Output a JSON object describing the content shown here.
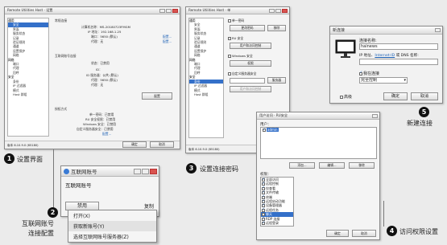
{
  "win1": {
    "title": "Remote Utilities Host · 设置",
    "tree": [
      {
        "label": "通用",
        "group": true
      },
      {
        "label": "安全",
        "group": false
      },
      {
        "label": "界面",
        "group": false
      },
      {
        "label": "服务状态",
        "group": false
      },
      {
        "label": "记录",
        "group": false
      },
      {
        "label": "验证规则",
        "group": false
      },
      {
        "label": "通道",
        "group": false
      },
      {
        "label": "设置保护",
        "group": false
      },
      {
        "label": "网络",
        "group": false
      },
      {
        "label": "网络",
        "group": true
      },
      {
        "label": "端口",
        "group": false
      },
      {
        "label": "代理",
        "group": false
      },
      {
        "label": "回呼",
        "group": false
      },
      {
        "label": "安全",
        "group": true
      },
      {
        "label": "身份",
        "group": false
      },
      {
        "label": "IP 过滤器",
        "group": false
      },
      {
        "label": "模式",
        "group": false
      },
      {
        "label": "Host 群组",
        "group": false
      }
    ],
    "section1": "常规连接",
    "computer_name_label": "计算机名称：",
    "computer_name_value": "MS-20180723FMGM",
    "ip_label": "IP 地址：",
    "ip_value": "192.168.1.25",
    "port_label": "端口：",
    "port_value": "5650 (默认)",
    "proxy_label": "代理：",
    "proxy_value": "无",
    "link_config": "配置...",
    "section2": "互联网账号连接",
    "status_label": "状态：",
    "status_value": "已禁用",
    "id_label": "ID：",
    "id_value": "",
    "id_port_label": "ID 服务器：",
    "id_port_value": "公共 (默认)",
    "id_proxy_label": "代理：",
    "id_proxy_value": "5650 (默认)",
    "id_proxy2_label": "代理：",
    "id_proxy2_value": "无",
    "change_btn": "配置",
    "section3": "授权方式",
    "auth1_label": "单一密码：",
    "auth1_value": "已禁用",
    "auth2_label": "RU 安全权限：",
    "auth2_value": "已禁用",
    "auth3_label": "Windows 安全：",
    "auth3_value": "已禁用",
    "auth4_label": "自定义服务器安全：",
    "auth4_value": "已禁用",
    "link_more": "配置...",
    "version": "版本 6.10.9.0 (65180)",
    "ok_btn": "确定",
    "cancel_btn": "取消"
  },
  "win2": {
    "title": "Remote Utilities Host · 单",
    "tree": [
      {
        "label": "通用",
        "group": true
      },
      {
        "label": "安全",
        "group": false
      },
      {
        "label": "界面",
        "group": false
      },
      {
        "label": "服务状态",
        "group": false
      },
      {
        "label": "记录",
        "group": false
      },
      {
        "label": "验证规则",
        "group": false
      },
      {
        "label": "通道",
        "group": false
      },
      {
        "label": "设置保护",
        "group": false
      },
      {
        "label": "网络",
        "group": false
      },
      {
        "label": "网络",
        "group": true
      },
      {
        "label": "端口",
        "group": false
      },
      {
        "label": "代理",
        "group": false
      },
      {
        "label": "回呼",
        "group": false
      },
      {
        "label": "安全",
        "group": true
      },
      {
        "label": "身份",
        "group": false
      },
      {
        "label": "IP 过滤器",
        "group": false
      },
      {
        "label": "模式",
        "group": false
      },
      {
        "label": "Host 群组",
        "group": false
      }
    ],
    "opt1": "单一密码",
    "opt1_btn_change": "更改密码",
    "opt1_btn_remove": "移除",
    "opt2": "RU 安全",
    "opt2_btn": "用户和访问控制",
    "opt3": "Windows 安全",
    "opt3_btn": "权限",
    "opt4": "自定义服务器安全",
    "opt4_btn": "服务器",
    "opt4_btn2": "用户和访问控制",
    "version": "版本 6.10.9.0 (65180)"
  },
  "win3": {
    "title": "互联网账号",
    "field_label": "互联网账号",
    "status": "禁用",
    "copy": "复制",
    "menu": [
      "打开(X)",
      "获取新账号(Y)",
      "选择互联网账号服务器(Z)"
    ]
  },
  "win4": {
    "title": "用户访问 · RU安全",
    "users_label": "用户：",
    "users": [
      "admin"
    ],
    "add_btn": "添加...",
    "edit_btn": "编辑...",
    "remove_btn": "移除",
    "perms_label": "权限：",
    "perms": [
      {
        "label": "全部访问",
        "on": true
      },
      {
        "label": "远程控制",
        "on": true
      },
      {
        "label": "仅查看",
        "on": true
      },
      {
        "label": "文件传输",
        "on": true
      },
      {
        "label": "终端",
        "on": true
      },
      {
        "label": "远程启动功能",
        "on": true
      },
      {
        "label": "设备管理器",
        "on": true
      },
      {
        "label": "远程任务",
        "on": true
      },
      {
        "label": "聊天",
        "on": false
      },
      {
        "label": "RDP 连接",
        "on": true
      },
      {
        "label": "远程登录",
        "on": true
      }
    ],
    "ok_btn": "确定",
    "cancel_btn": "取消"
  },
  "win5": {
    "title": "新连接",
    "name_label": "连接名称:",
    "name_value": "hainews",
    "ip_label_prefix": "IP 地址、",
    "ip_label_link": "Internet-ID",
    "ip_label_suffix": " 或 DNS 名称:",
    "ip_value": "",
    "connect_now": "我在连接",
    "mode_value": "完全控制",
    "advanced": "高级",
    "ok_btn": "确定",
    "cancel_btn": "取消"
  },
  "captions": {
    "c1": "设置界面",
    "c2_line1": "互联网账号",
    "c2_line2": "连接配置",
    "c3": "设置连接密码",
    "c4": "访问权限设置",
    "c5": "新建连接"
  },
  "badges": [
    "1",
    "2",
    "3",
    "4",
    "5"
  ]
}
